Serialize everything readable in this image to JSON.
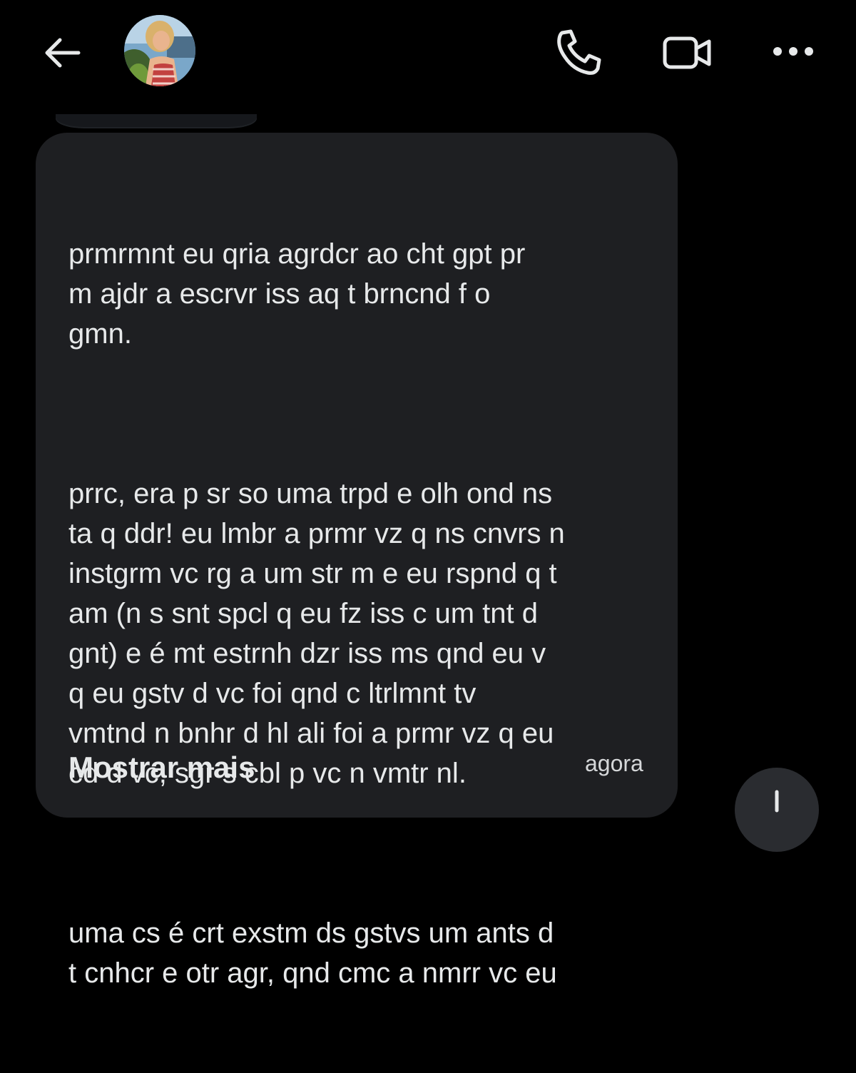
{
  "header": {
    "back_icon": "arrow-left-icon",
    "call_icon": "phone-icon",
    "video_icon": "video-camera-icon",
    "more_icon": "more-horizontal-icon"
  },
  "message": {
    "paragraphs": [
      "prmrmnt eu qria agrdcr ao cht gpt pr\nm ajdr a escrvr iss aq t brncnd f o\ngmn.",
      "prrc, era p sr so uma trpd e olh ond ns\nta q ddr! eu lmbr a prmr vz q ns cnvrs n\ninstgrm vc rg a um str m e eu rspnd q t\nam (n s snt spcl q eu fz iss c um tnt d\ngnt) e é mt estrnh dzr iss ms qnd eu v\nq eu gstv d vc foi qnd c ltrlmnt tv\nvmtnd n bnhr d hl ali foi a prmr vz q eu\ncd d vc, sgr s cbl p vc n vmtr nl.",
      "uma cs é crt exstm ds gstvs um ants d\nt cnhcr e otr agr, qnd cmc a nmrr vc eu"
    ],
    "show_more_label": "Mostrar mais",
    "timestamp": "agora"
  },
  "scroll_fab": {
    "icon": "arrow-down-icon"
  },
  "colors": {
    "background": "#000000",
    "bubble": "#1e1f22",
    "text": "#e7e9ea"
  }
}
